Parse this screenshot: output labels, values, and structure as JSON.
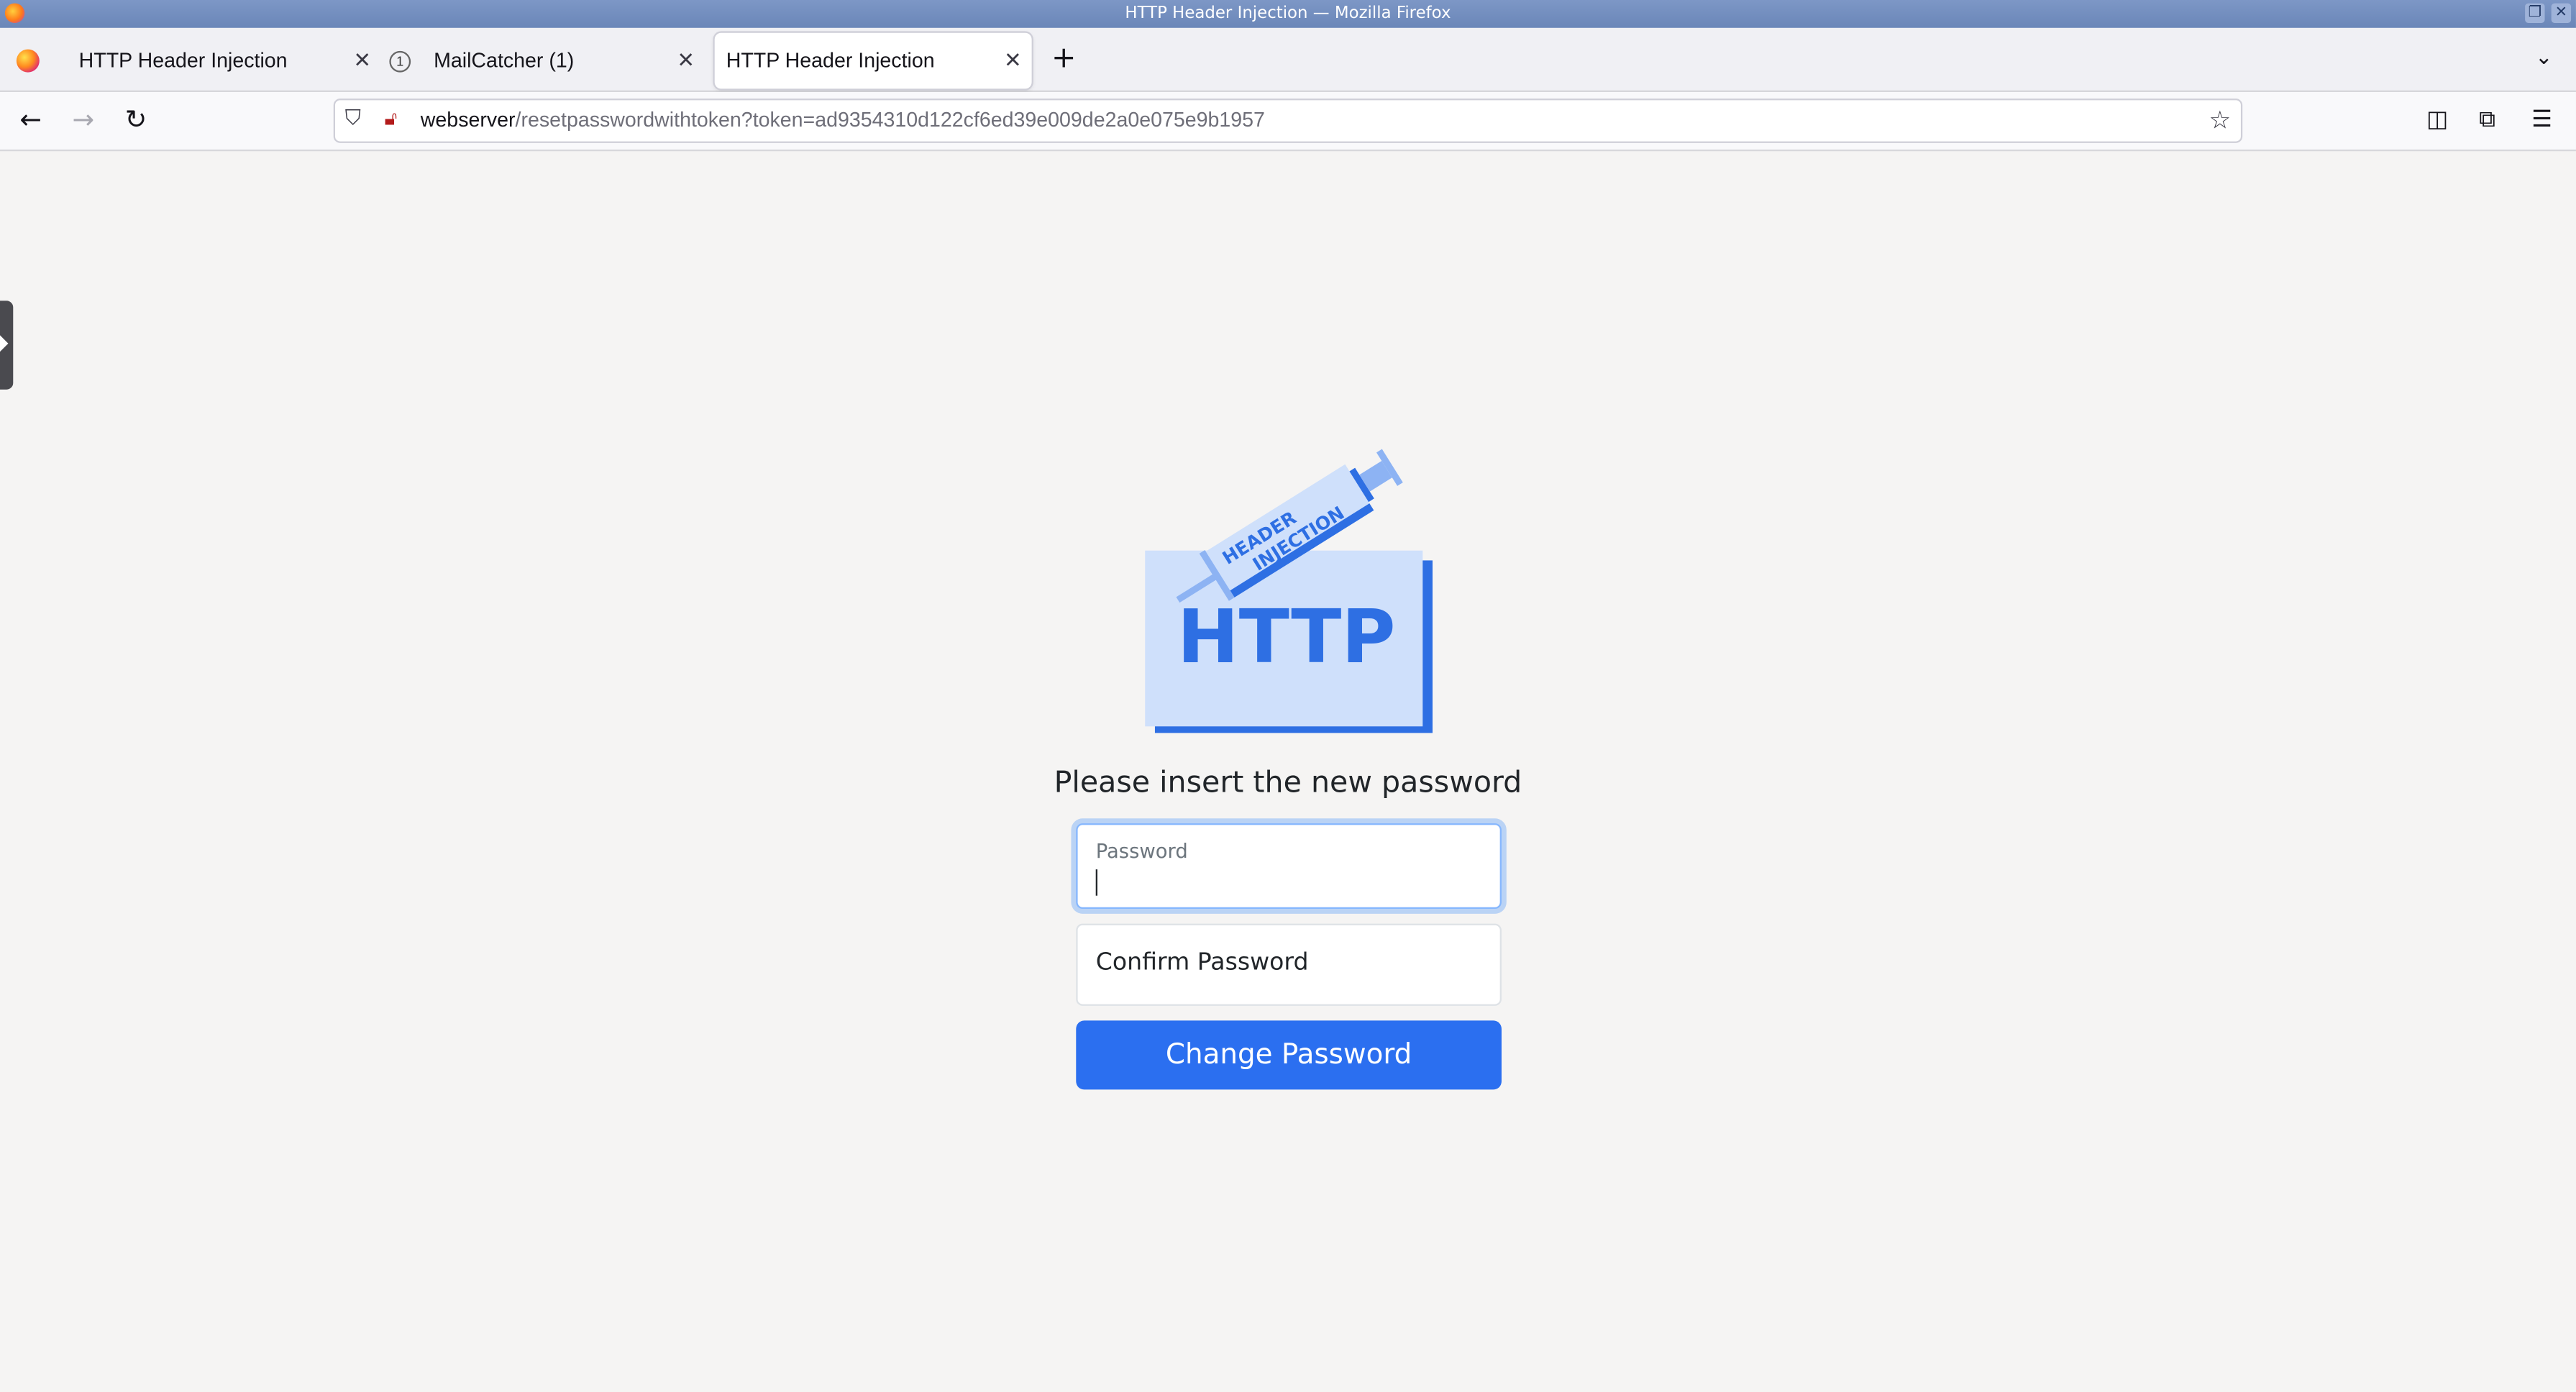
{
  "window": {
    "title": "HTTP Header Injection — Mozilla Firefox"
  },
  "tabs": [
    {
      "label": "HTTP Header Injection",
      "active": false
    },
    {
      "label": "MailCatcher (1)",
      "active": false
    },
    {
      "label": "HTTP Header Injection",
      "active": true
    }
  ],
  "navbar": {
    "url_host": "webserver",
    "url_path": "/resetpasswordwithtoken?token=ad9354310d122cf6ed39e009de2a0e075e9b1957"
  },
  "logo": {
    "main_text": "HTTP",
    "syringe_line1": "HEADER",
    "syringe_line2": "INJECTION",
    "colors": {
      "card": "#cfe0fb",
      "blue": "#2e6fe3",
      "light_blue": "#8db3f3"
    }
  },
  "form": {
    "heading": "Please insert the new password",
    "password_label": "Password",
    "confirm_placeholder": "Confirm Password",
    "submit_label": "Change Password",
    "accent_color": "#2b6ff0"
  }
}
